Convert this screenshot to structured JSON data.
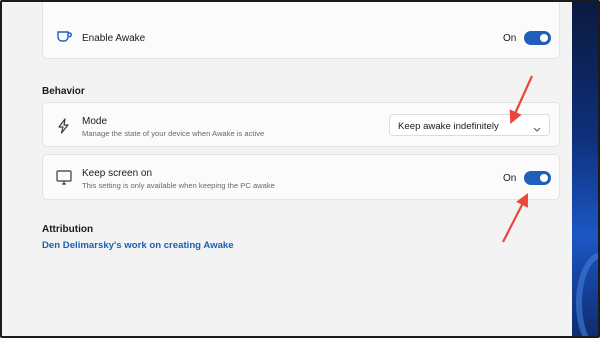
{
  "enable_awake": {
    "label": "Enable Awake",
    "state": "On",
    "icon": "coffee-cup-icon"
  },
  "behavior": {
    "heading": "Behavior",
    "mode": {
      "label": "Mode",
      "description": "Manage the state of your device when Awake is active",
      "selected": "Keep awake indefinitely",
      "icon": "lightning-icon"
    },
    "keep_screen_on": {
      "label": "Keep screen on",
      "description": "This setting is only available when keeping the PC awake",
      "state": "On",
      "icon": "monitor-icon"
    }
  },
  "attribution": {
    "heading": "Attribution",
    "link": "Den Delimarsky's work on creating Awake"
  },
  "colors": {
    "accent": "#1f5fb8",
    "link": "#1a5fb4",
    "annotation_arrow": "#e8473b"
  }
}
